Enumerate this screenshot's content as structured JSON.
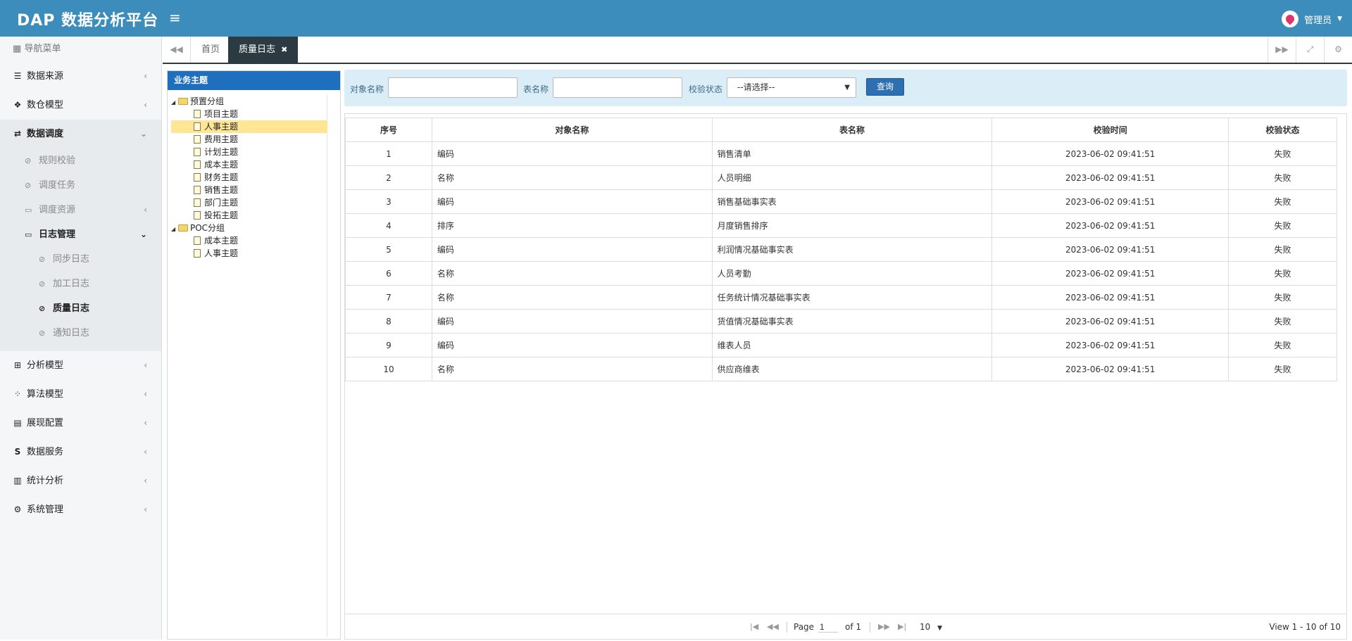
{
  "app": {
    "title": "DAP 数据分析平台",
    "menu_icon": "≡"
  },
  "user": {
    "name": "管理员"
  },
  "sidebar": {
    "header": "导航菜单",
    "items": [
      {
        "label": "数据来源"
      },
      {
        "label": "数仓模型"
      },
      {
        "label": "数据调度"
      },
      {
        "label": "分析模型"
      },
      {
        "label": "算法模型"
      },
      {
        "label": "展现配置"
      },
      {
        "label": "数据服务"
      },
      {
        "label": "统计分析"
      },
      {
        "label": "系统管理"
      }
    ],
    "schedule_children": [
      {
        "label": "规则校验"
      },
      {
        "label": "调度任务"
      },
      {
        "label": "调度资源"
      },
      {
        "label": "日志管理"
      }
    ],
    "log_children": [
      {
        "label": "同步日志"
      },
      {
        "label": "加工日志"
      },
      {
        "label": "质量日志"
      },
      {
        "label": "通知日志"
      }
    ]
  },
  "tabs": [
    {
      "label": "首页"
    },
    {
      "label": "质量日志"
    }
  ],
  "tree": {
    "title": "业务主题",
    "groups": [
      {
        "label": "预置分组",
        "children": [
          "项目主题",
          "人事主题",
          "费用主题",
          "计划主题",
          "成本主题",
          "财务主题",
          "销售主题",
          "部门主题",
          "投拓主题"
        ]
      },
      {
        "label": "POC分组",
        "children": [
          "成本主题",
          "人事主题"
        ]
      }
    ]
  },
  "search": {
    "object_label": "对象名称",
    "table_label": "表名称",
    "status_label": "校验状态",
    "status_placeholder": "--请选择--",
    "button": "查询"
  },
  "grid": {
    "columns": [
      "序号",
      "对象名称",
      "表名称",
      "校验时间",
      "校验状态"
    ],
    "rows": [
      [
        "1",
        "编码",
        "销售清单",
        "2023-06-02 09:41:51",
        "失败"
      ],
      [
        "2",
        "名称",
        "人员明细",
        "2023-06-02 09:41:51",
        "失败"
      ],
      [
        "3",
        "编码",
        "销售基础事实表",
        "2023-06-02 09:41:51",
        "失败"
      ],
      [
        "4",
        "排序",
        "月度销售排序",
        "2023-06-02 09:41:51",
        "失败"
      ],
      [
        "5",
        "编码",
        "利润情况基础事实表",
        "2023-06-02 09:41:51",
        "失败"
      ],
      [
        "6",
        "名称",
        "人员考勤",
        "2023-06-02 09:41:51",
        "失败"
      ],
      [
        "7",
        "名称",
        "任务统计情况基础事实表",
        "2023-06-02 09:41:51",
        "失败"
      ],
      [
        "8",
        "编码",
        "货值情况基础事实表",
        "2023-06-02 09:41:51",
        "失败"
      ],
      [
        "9",
        "编码",
        "维表人员",
        "2023-06-02 09:41:51",
        "失败"
      ],
      [
        "10",
        "名称",
        "供应商维表",
        "2023-06-02 09:41:51",
        "失败"
      ]
    ]
  },
  "pager": {
    "page_label": "Page",
    "page_value": "1",
    "of_label": "of 1",
    "rows_per_page": "10",
    "summary": "View 1 - 10 of 10"
  }
}
